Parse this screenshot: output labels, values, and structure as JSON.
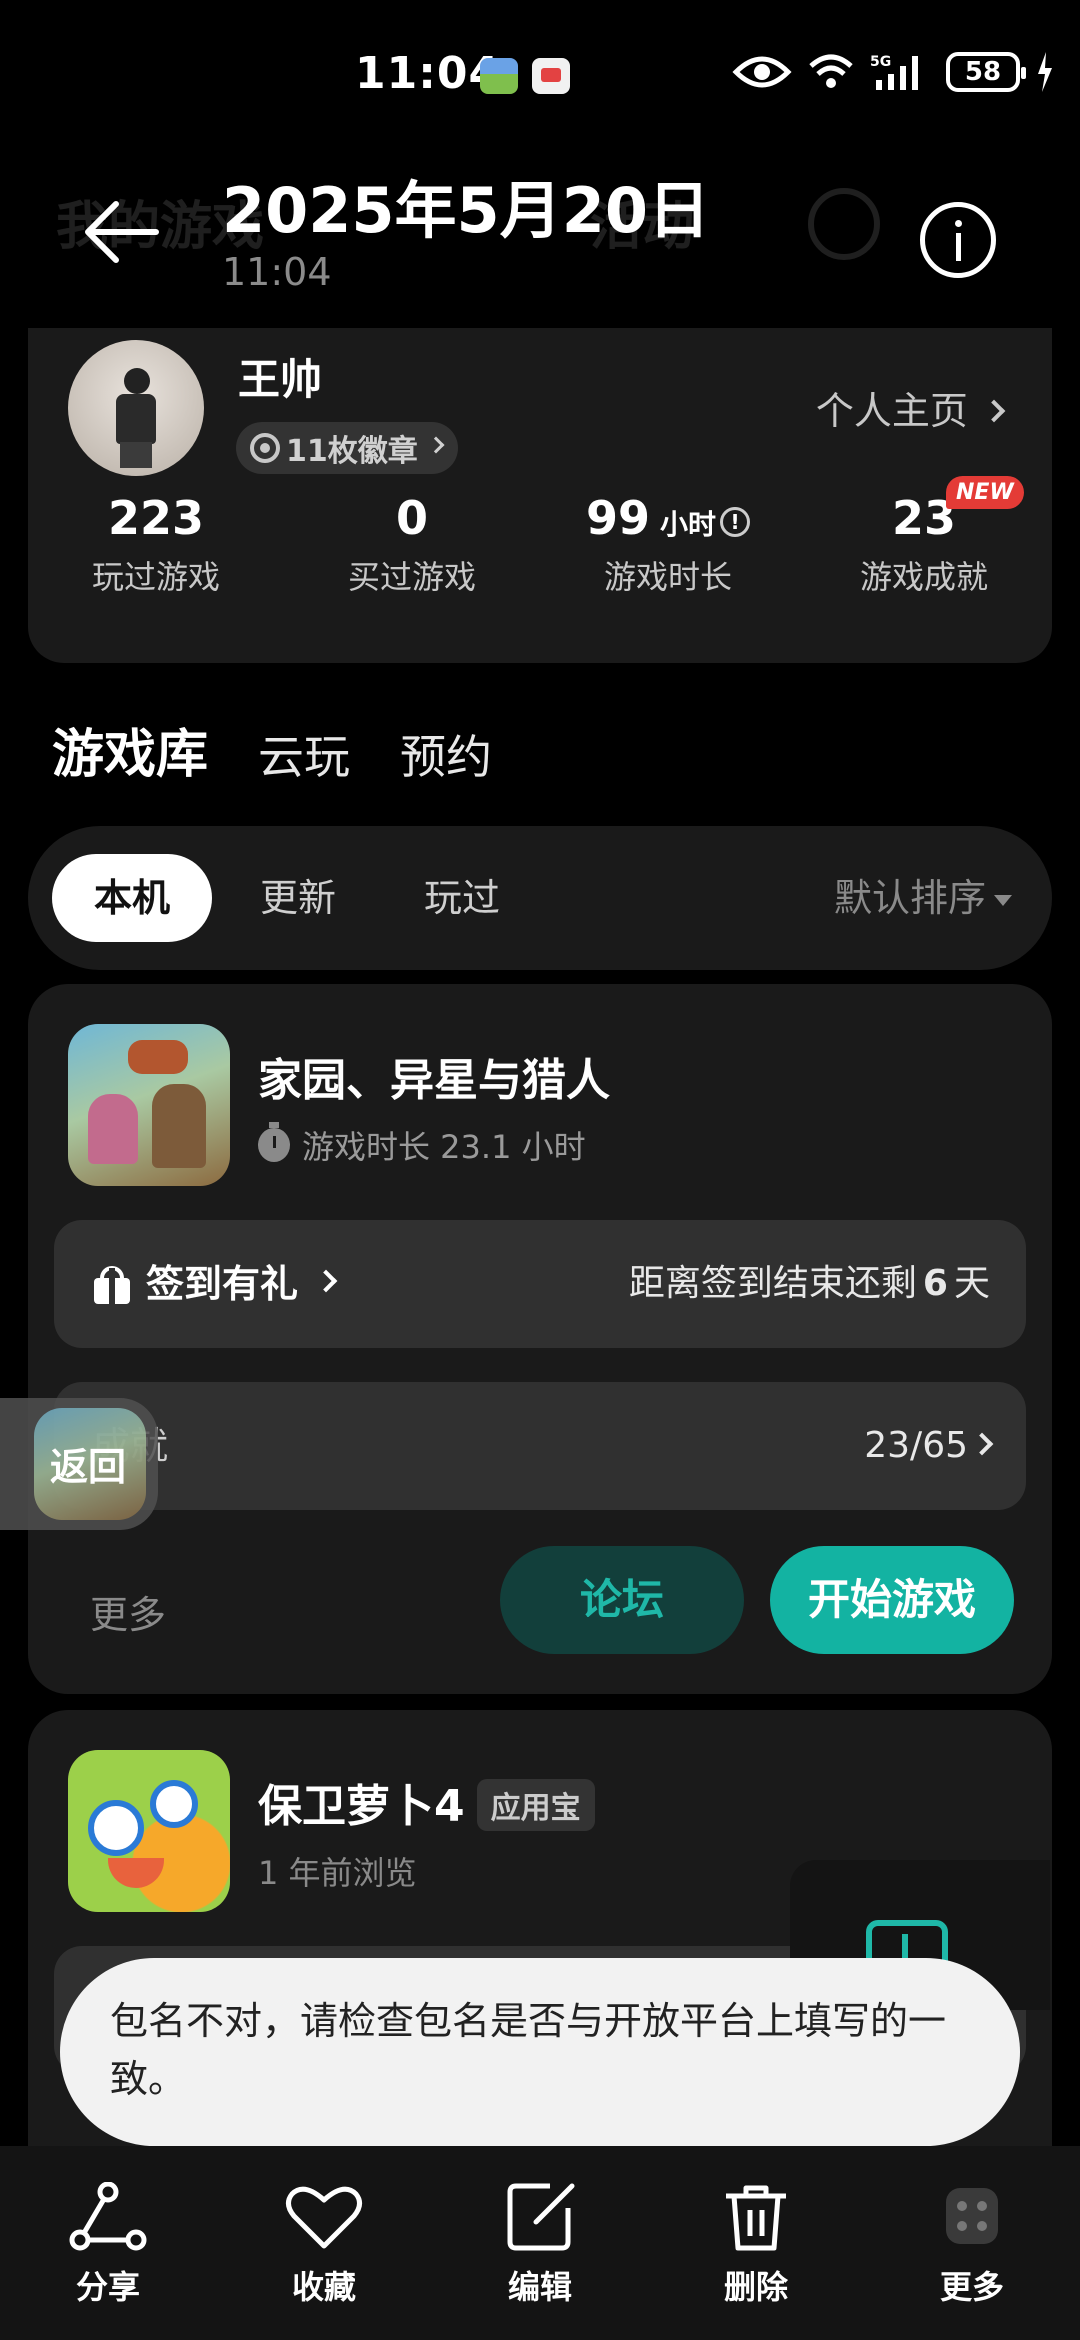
{
  "status_bar": {
    "time": "11:04",
    "network": "5G",
    "battery": "58"
  },
  "header": {
    "date": "2025年5月20日",
    "time": "11:04",
    "ghost_title": "我的游戏",
    "ghost_activity": "活动"
  },
  "profile": {
    "name": "王帅",
    "badges": "11枚徽章",
    "homepage_link": "个人主页",
    "stats": [
      {
        "value": "223",
        "label": "玩过游戏"
      },
      {
        "value": "0",
        "label": "买过游戏"
      },
      {
        "value": "99",
        "unit": "小时",
        "label": "游戏时长"
      },
      {
        "value": "23",
        "label": "游戏成就",
        "badge": "NEW"
      }
    ]
  },
  "main_tabs": [
    "游戏库",
    "云玩",
    "预约"
  ],
  "sub_tabs": {
    "items": [
      "本机",
      "更新",
      "玩过"
    ],
    "sort": "默认排序"
  },
  "game1": {
    "title": "家园、异星与猎人",
    "playtime": "游戏时长 23.1 小时",
    "checkin_label": "签到有礼",
    "checkin_prefix": "距离签到结束还剩",
    "checkin_days": "6",
    "checkin_suffix": "天",
    "achievement_label": "成就",
    "achievement_progress": "23/65",
    "more": "更多",
    "forum": "论坛",
    "play": "开始游戏"
  },
  "floating_back": "返回",
  "game2": {
    "title": "保卫萝卜4",
    "tag": "应用宝",
    "subtitle": "1 年前浏览"
  },
  "toast": "包名不对，请检查包名是否与开放平台上填写的一致。",
  "bottom_bar": [
    "分享",
    "收藏",
    "编辑",
    "删除",
    "更多"
  ],
  "colors": {
    "accent": "#13b3a2",
    "card": "#1a1a1a",
    "background": "#000000"
  }
}
